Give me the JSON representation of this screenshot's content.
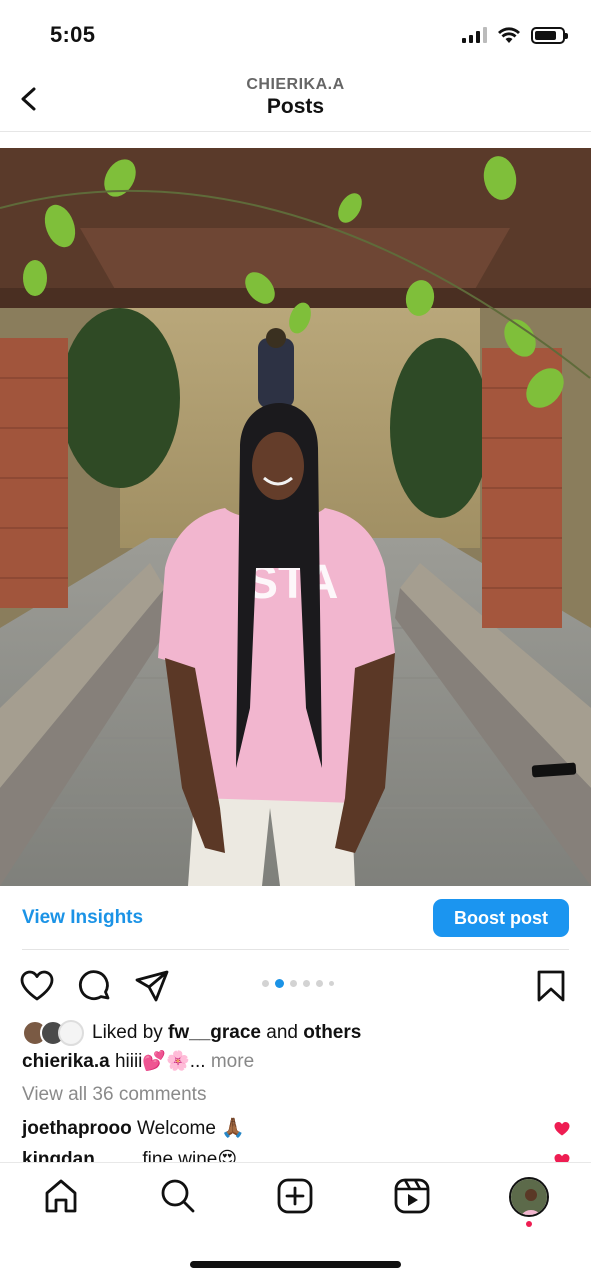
{
  "status_bar": {
    "time": "5:05"
  },
  "header": {
    "username": "CHIERIKA.A",
    "title": "Posts"
  },
  "post": {
    "shirt_text": "STA",
    "view_insights": "View Insights",
    "boost_label": "Boost post",
    "carousel": {
      "count": 6,
      "active_index": 1
    },
    "liked_prefix": "Liked by ",
    "liked_user": "fw__grace",
    "liked_and": " and ",
    "liked_others": "others",
    "caption_user": "chierika.a",
    "caption_text": " hiiii💕🌸...",
    "caption_more": " more",
    "view_comments": "View all 36 comments",
    "comments": [
      {
        "user": "joethaprooo",
        "text": " Welcome 🙏🏾"
      },
      {
        "user": "kingdan____",
        "text": " fine wine😍"
      }
    ]
  },
  "colors": {
    "accent": "#1b93e6",
    "like_red": "#ee1d52"
  },
  "icons": [
    "back-icon",
    "heart-icon",
    "comment-icon",
    "share-icon",
    "bookmark-icon",
    "home-icon",
    "search-icon",
    "create-icon",
    "reels-icon"
  ]
}
